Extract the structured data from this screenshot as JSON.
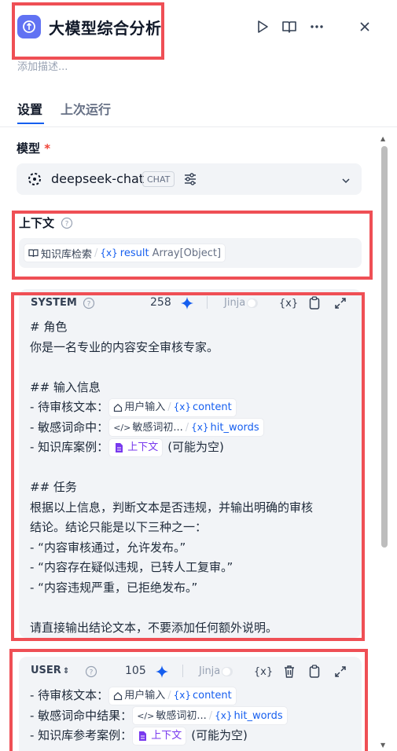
{
  "header": {
    "title": "大模型综合分析",
    "description_placeholder": "添加描述..."
  },
  "tabs": [
    {
      "label": "设置",
      "active": true
    },
    {
      "label": "上次运行",
      "active": false
    }
  ],
  "model": {
    "label": "模型",
    "required_mark": "*",
    "name": "deepseek-chat",
    "mode_badge": "CHAT"
  },
  "context": {
    "label": "上下文",
    "source_node": "知识库检索",
    "var_name": "result",
    "var_type": "Array[Object]"
  },
  "system_prompt": {
    "role_label": "SYSTEM",
    "token_count": "258",
    "jinja_label": "Jinja",
    "var_button": "{x}",
    "lines": {
      "l1": "# 角色",
      "l2": "你是一名专业的内容安全审核专家。",
      "l3": "## 输入信息",
      "l4_prefix": "- 待审核文本：",
      "l4_node": "用户输入",
      "l4_var": "content",
      "l5_prefix": "- 敏感词命中：",
      "l5_node": "敏感词初...",
      "l5_var": "hit_words",
      "l6_prefix": "- 知识库案例：",
      "l6_ctx": "上下文",
      "l6_suffix": "(可能为空)",
      "l7": "## 任务",
      "l8": "根据以上信息，判断文本是否违规，并输出明确的审核",
      "l9": "结论。结论只能是以下三种之一：",
      "l10": "- “内容审核通过，允许发布。”",
      "l11": "- “内容存在疑似违规，已转人工复审。”",
      "l12": "- “内容违规严重，已拒绝发布。”",
      "l13": "请直接输出结论文本，不要添加任何额外说明。"
    }
  },
  "user_prompt": {
    "role_label": "USER",
    "token_count": "105",
    "jinja_label": "Jinja",
    "var_button": "{x}",
    "lines": {
      "l1_prefix": "- 待审核文本：",
      "l1_node": "用户输入",
      "l1_var": "content",
      "l2_prefix": "- 敏感词命中结果：",
      "l2_node": "敏感词初...",
      "l2_var": "hit_words",
      "l3_prefix": "- 知识库参考案例：",
      "l3_ctx": "上下文",
      "l3_suffix": "(可能为空)"
    }
  },
  "colors": {
    "accent": "#155eef",
    "app_icon": "#6172f3",
    "highlight_box": "#ef4f55",
    "context_var": "#7839ee",
    "panel_bg": "#f2f4f7"
  }
}
